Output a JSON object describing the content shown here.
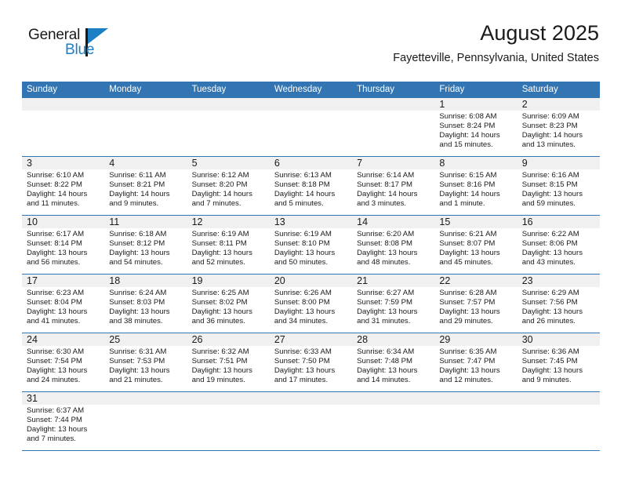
{
  "brand": {
    "name_part1": "General",
    "name_part2": "Blue",
    "accent_color": "#1d7fc4",
    "logo_icon": "triangle-flag-icon"
  },
  "header": {
    "month_title": "August 2025",
    "location": "Fayetteville, Pennsylvania, United States"
  },
  "calendar": {
    "header_color": "#3275b2",
    "daynum_band_color": "#f0f0f0",
    "weekdays": [
      "Sunday",
      "Monday",
      "Tuesday",
      "Wednesday",
      "Thursday",
      "Friday",
      "Saturday"
    ],
    "weeks": [
      [
        {
          "day": "",
          "lines": []
        },
        {
          "day": "",
          "lines": []
        },
        {
          "day": "",
          "lines": []
        },
        {
          "day": "",
          "lines": []
        },
        {
          "day": "",
          "lines": []
        },
        {
          "day": "1",
          "lines": [
            "Sunrise: 6:08 AM",
            "Sunset: 8:24 PM",
            "Daylight: 14 hours",
            "and 15 minutes."
          ]
        },
        {
          "day": "2",
          "lines": [
            "Sunrise: 6:09 AM",
            "Sunset: 8:23 PM",
            "Daylight: 14 hours",
            "and 13 minutes."
          ]
        }
      ],
      [
        {
          "day": "3",
          "lines": [
            "Sunrise: 6:10 AM",
            "Sunset: 8:22 PM",
            "Daylight: 14 hours",
            "and 11 minutes."
          ]
        },
        {
          "day": "4",
          "lines": [
            "Sunrise: 6:11 AM",
            "Sunset: 8:21 PM",
            "Daylight: 14 hours",
            "and 9 minutes."
          ]
        },
        {
          "day": "5",
          "lines": [
            "Sunrise: 6:12 AM",
            "Sunset: 8:20 PM",
            "Daylight: 14 hours",
            "and 7 minutes."
          ]
        },
        {
          "day": "6",
          "lines": [
            "Sunrise: 6:13 AM",
            "Sunset: 8:18 PM",
            "Daylight: 14 hours",
            "and 5 minutes."
          ]
        },
        {
          "day": "7",
          "lines": [
            "Sunrise: 6:14 AM",
            "Sunset: 8:17 PM",
            "Daylight: 14 hours",
            "and 3 minutes."
          ]
        },
        {
          "day": "8",
          "lines": [
            "Sunrise: 6:15 AM",
            "Sunset: 8:16 PM",
            "Daylight: 14 hours",
            "and 1 minute."
          ]
        },
        {
          "day": "9",
          "lines": [
            "Sunrise: 6:16 AM",
            "Sunset: 8:15 PM",
            "Daylight: 13 hours",
            "and 59 minutes."
          ]
        }
      ],
      [
        {
          "day": "10",
          "lines": [
            "Sunrise: 6:17 AM",
            "Sunset: 8:14 PM",
            "Daylight: 13 hours",
            "and 56 minutes."
          ]
        },
        {
          "day": "11",
          "lines": [
            "Sunrise: 6:18 AM",
            "Sunset: 8:12 PM",
            "Daylight: 13 hours",
            "and 54 minutes."
          ]
        },
        {
          "day": "12",
          "lines": [
            "Sunrise: 6:19 AM",
            "Sunset: 8:11 PM",
            "Daylight: 13 hours",
            "and 52 minutes."
          ]
        },
        {
          "day": "13",
          "lines": [
            "Sunrise: 6:19 AM",
            "Sunset: 8:10 PM",
            "Daylight: 13 hours",
            "and 50 minutes."
          ]
        },
        {
          "day": "14",
          "lines": [
            "Sunrise: 6:20 AM",
            "Sunset: 8:08 PM",
            "Daylight: 13 hours",
            "and 48 minutes."
          ]
        },
        {
          "day": "15",
          "lines": [
            "Sunrise: 6:21 AM",
            "Sunset: 8:07 PM",
            "Daylight: 13 hours",
            "and 45 minutes."
          ]
        },
        {
          "day": "16",
          "lines": [
            "Sunrise: 6:22 AM",
            "Sunset: 8:06 PM",
            "Daylight: 13 hours",
            "and 43 minutes."
          ]
        }
      ],
      [
        {
          "day": "17",
          "lines": [
            "Sunrise: 6:23 AM",
            "Sunset: 8:04 PM",
            "Daylight: 13 hours",
            "and 41 minutes."
          ]
        },
        {
          "day": "18",
          "lines": [
            "Sunrise: 6:24 AM",
            "Sunset: 8:03 PM",
            "Daylight: 13 hours",
            "and 38 minutes."
          ]
        },
        {
          "day": "19",
          "lines": [
            "Sunrise: 6:25 AM",
            "Sunset: 8:02 PM",
            "Daylight: 13 hours",
            "and 36 minutes."
          ]
        },
        {
          "day": "20",
          "lines": [
            "Sunrise: 6:26 AM",
            "Sunset: 8:00 PM",
            "Daylight: 13 hours",
            "and 34 minutes."
          ]
        },
        {
          "day": "21",
          "lines": [
            "Sunrise: 6:27 AM",
            "Sunset: 7:59 PM",
            "Daylight: 13 hours",
            "and 31 minutes."
          ]
        },
        {
          "day": "22",
          "lines": [
            "Sunrise: 6:28 AM",
            "Sunset: 7:57 PM",
            "Daylight: 13 hours",
            "and 29 minutes."
          ]
        },
        {
          "day": "23",
          "lines": [
            "Sunrise: 6:29 AM",
            "Sunset: 7:56 PM",
            "Daylight: 13 hours",
            "and 26 minutes."
          ]
        }
      ],
      [
        {
          "day": "24",
          "lines": [
            "Sunrise: 6:30 AM",
            "Sunset: 7:54 PM",
            "Daylight: 13 hours",
            "and 24 minutes."
          ]
        },
        {
          "day": "25",
          "lines": [
            "Sunrise: 6:31 AM",
            "Sunset: 7:53 PM",
            "Daylight: 13 hours",
            "and 21 minutes."
          ]
        },
        {
          "day": "26",
          "lines": [
            "Sunrise: 6:32 AM",
            "Sunset: 7:51 PM",
            "Daylight: 13 hours",
            "and 19 minutes."
          ]
        },
        {
          "day": "27",
          "lines": [
            "Sunrise: 6:33 AM",
            "Sunset: 7:50 PM",
            "Daylight: 13 hours",
            "and 17 minutes."
          ]
        },
        {
          "day": "28",
          "lines": [
            "Sunrise: 6:34 AM",
            "Sunset: 7:48 PM",
            "Daylight: 13 hours",
            "and 14 minutes."
          ]
        },
        {
          "day": "29",
          "lines": [
            "Sunrise: 6:35 AM",
            "Sunset: 7:47 PM",
            "Daylight: 13 hours",
            "and 12 minutes."
          ]
        },
        {
          "day": "30",
          "lines": [
            "Sunrise: 6:36 AM",
            "Sunset: 7:45 PM",
            "Daylight: 13 hours",
            "and 9 minutes."
          ]
        }
      ],
      [
        {
          "day": "31",
          "lines": [
            "Sunrise: 6:37 AM",
            "Sunset: 7:44 PM",
            "Daylight: 13 hours",
            "and 7 minutes."
          ]
        },
        {
          "day": "",
          "lines": []
        },
        {
          "day": "",
          "lines": []
        },
        {
          "day": "",
          "lines": []
        },
        {
          "day": "",
          "lines": []
        },
        {
          "day": "",
          "lines": []
        },
        {
          "day": "",
          "lines": []
        }
      ]
    ]
  }
}
